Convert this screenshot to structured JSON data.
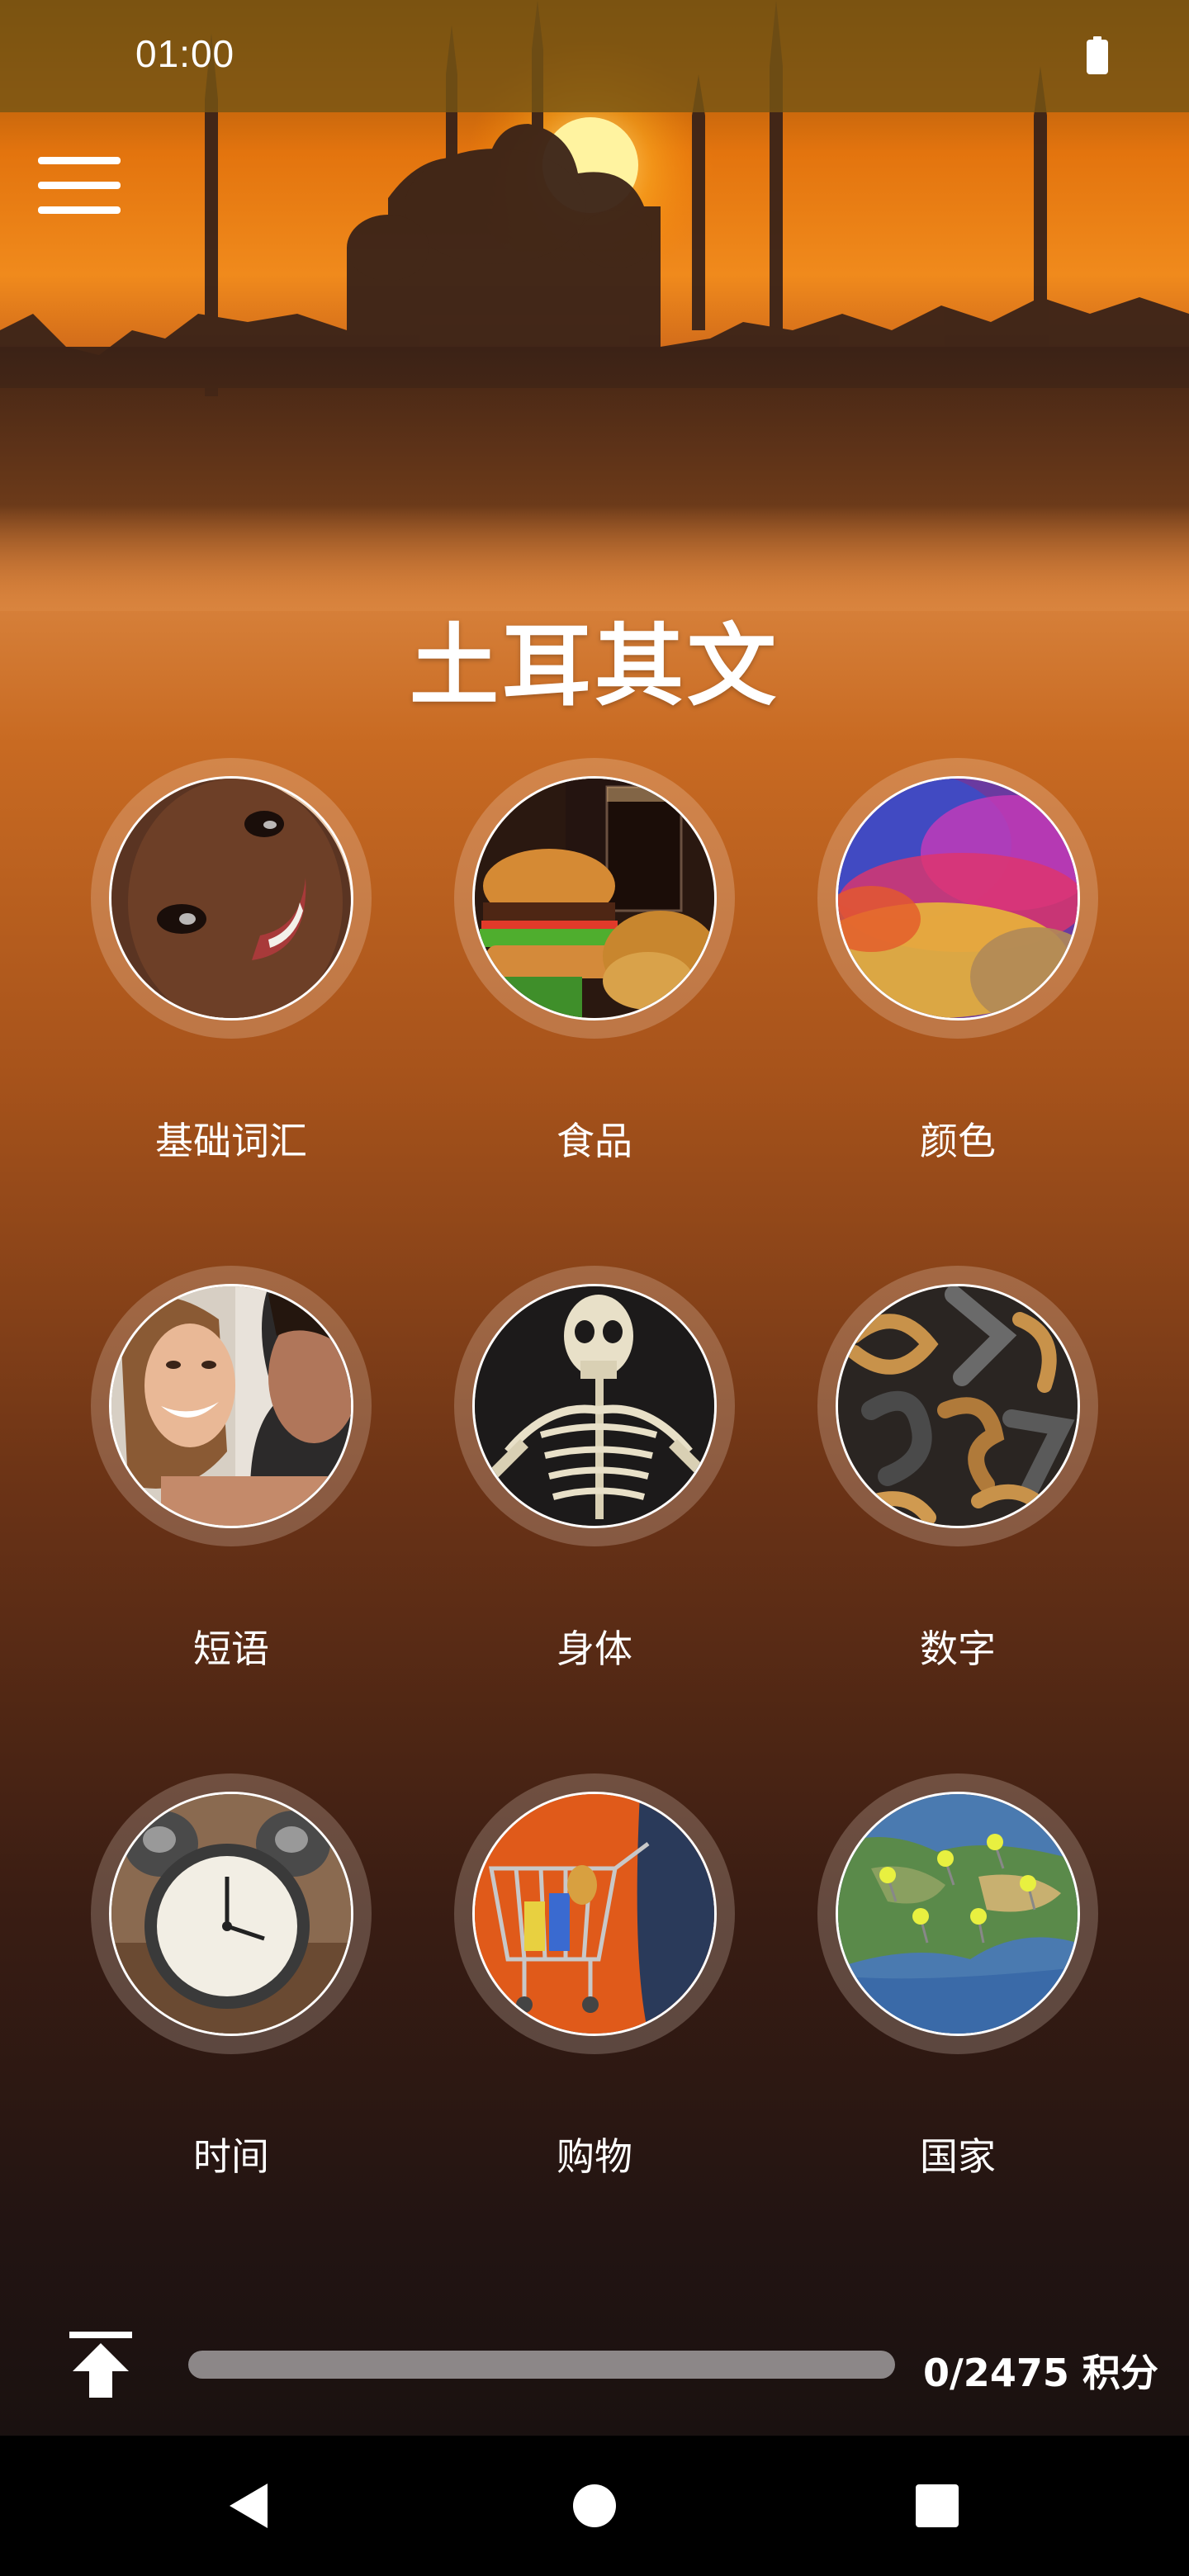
{
  "status_bar": {
    "time": "01:00"
  },
  "header": {
    "title": "土耳其文"
  },
  "categories": [
    {
      "label": "基础词汇",
      "icon": "baby-face-photo"
    },
    {
      "label": "食品",
      "icon": "burger-meal-photo"
    },
    {
      "label": "颜色",
      "icon": "color-powder-photo"
    },
    {
      "label": "短语",
      "icon": "smiling-woman-photo"
    },
    {
      "label": "身体",
      "icon": "skeleton-photo"
    },
    {
      "label": "数字",
      "icon": "metal-numbers-photo"
    },
    {
      "label": "时间",
      "icon": "alarm-clock-photo"
    },
    {
      "label": "购物",
      "icon": "shopping-cart-photo"
    },
    {
      "label": "国家",
      "icon": "map-pins-photo"
    }
  ],
  "footer": {
    "points_text": "0/2475 积分",
    "points_earned": 0,
    "points_total": 2475
  },
  "colors": {
    "accent": "#f0a030",
    "progress_track": "#8c8788"
  }
}
